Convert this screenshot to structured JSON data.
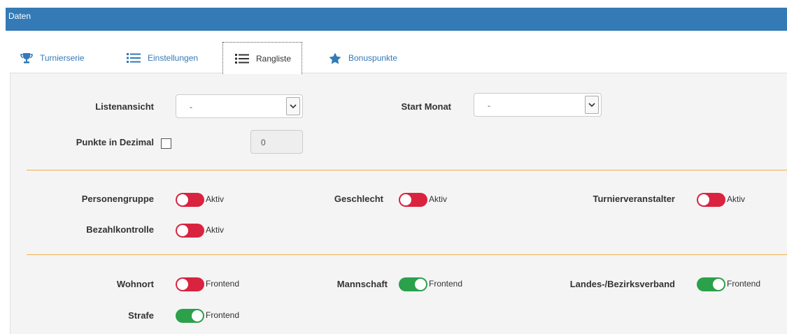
{
  "window": {
    "title": "Daten"
  },
  "tabs": [
    {
      "label": "Turnierserie",
      "icon": "trophy-icon"
    },
    {
      "label": "Einstellungen",
      "icon": "list-icon"
    },
    {
      "label": "Rangliste",
      "icon": "list-icon",
      "active": true
    },
    {
      "label": "Bonuspunkte",
      "icon": "star-icon"
    }
  ],
  "form": {
    "listenansicht": {
      "label": "Listenansicht",
      "value": "-"
    },
    "start_monat": {
      "label": "Start Monat",
      "value": "-"
    },
    "punkte_dezimal": {
      "label": "Punkte in Dezimal",
      "checked": false,
      "value": "0"
    }
  },
  "toggles_aktiv": [
    {
      "label": "Personengruppe",
      "state": "off",
      "text": "Aktiv"
    },
    {
      "label": "Geschlecht",
      "state": "off",
      "text": "Aktiv"
    },
    {
      "label": "Turnierveranstalter",
      "state": "off",
      "text": "Aktiv"
    },
    {
      "label": "Bezahlkontrolle",
      "state": "off",
      "text": "Aktiv"
    }
  ],
  "toggles_frontend": [
    {
      "label": "Wohnort",
      "state": "off",
      "text": "Frontend"
    },
    {
      "label": "Mannschaft",
      "state": "on",
      "text": "Frontend"
    },
    {
      "label": "Landes-/Bezirksverband",
      "state": "on",
      "text": "Frontend"
    },
    {
      "label": "Strafe",
      "state": "on",
      "text": "Frontend"
    }
  ],
  "colors": {
    "header": "#337ab7",
    "toggle_on": "#2aa14a",
    "toggle_off": "#d9233f",
    "divider": "#f0ad4e"
  }
}
